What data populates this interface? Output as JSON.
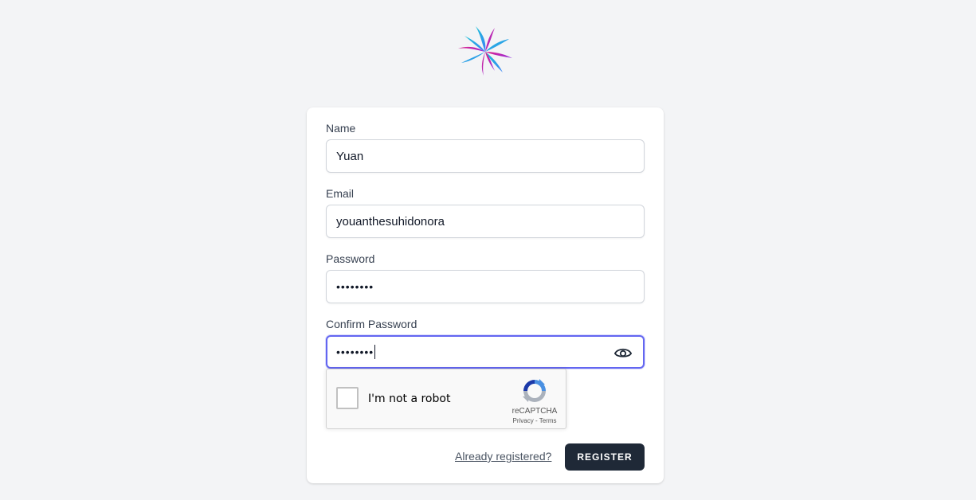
{
  "logo": {
    "icon": "flower-logo-icon"
  },
  "form": {
    "name_label": "Name",
    "name_value": "Yuan",
    "email_label": "Email",
    "email_value": "youanthesuhidonora",
    "password_label": "Password",
    "password_value": "••••••••",
    "confirm_label": "Confirm Password",
    "confirm_value": "••••••••",
    "show_password_icon": "eye-icon"
  },
  "recaptcha": {
    "checkbox_label": "I'm not a robot",
    "brand": "reCAPTCHA",
    "links": "Privacy - Terms"
  },
  "actions": {
    "already_registered": "Already registered?",
    "register_label": "REGISTER"
  },
  "colors": {
    "background": "#f3f4f6",
    "focus_ring": "#6366f1",
    "button": "#1f2937"
  }
}
